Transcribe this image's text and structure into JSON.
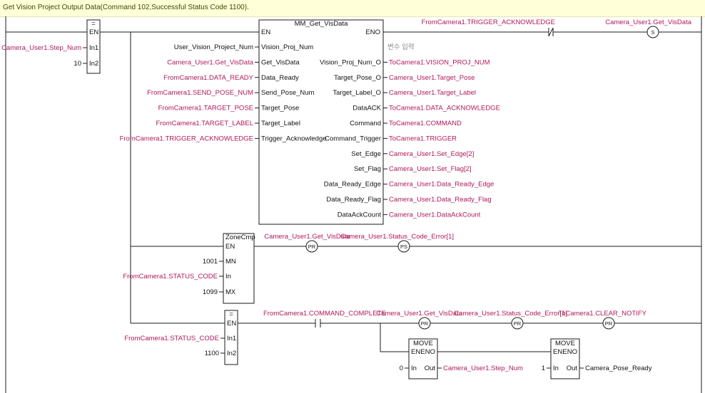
{
  "banner": {
    "comment": "Get Vision Project Output Data(Command 102,Successful Status Code 1100)."
  },
  "rung1": {
    "eq_block": {
      "title": "=",
      "en": "EN",
      "in1": "In1",
      "in2": "In2",
      "in1_var": "Camera_User1.Step_Num",
      "in2_const": "10"
    },
    "fb": {
      "title": "MM_Get_VisData",
      "en": "EN",
      "eno": "ENO",
      "inputs": [
        {
          "pin": "Vision_Proj_Num",
          "var": "User_Vision_Project_Num"
        },
        {
          "pin": "Get_VisData",
          "var": "Camera_User1.Get_VisData"
        },
        {
          "pin": "Data_Ready",
          "var": "FromCamera1.DATA_READY"
        },
        {
          "pin": "Send_Pose_Num",
          "var": "FromCamera1.SEND_POSE_NUM"
        },
        {
          "pin": "Target_Pose",
          "var": "FromCamera1.TARGET_POSE"
        },
        {
          "pin": "Target_Label",
          "var": "FromCamera1.TARGET_LABEL"
        },
        {
          "pin": "Trigger_Acknowledge",
          "var": "FromCamera1.TRIGGER_ACKNOWLEDGE"
        }
      ],
      "eno_out": "변수 입력",
      "outputs": [
        {
          "pin": "Vision_Proj_Num_O",
          "var": "ToCamera1.VISION_PROJ_NUM"
        },
        {
          "pin": "Target_Pose_O",
          "var": "Camera_User1.Target_Pose"
        },
        {
          "pin": "Target_Label_O",
          "var": "Camera_User1.Target_Label"
        },
        {
          "pin": "DataACK",
          "var": "ToCamera1.DATA_ACKNOWLEDGE"
        },
        {
          "pin": "Command",
          "var": "ToCamera1.COMMAND"
        },
        {
          "pin": "Command_Trigger",
          "var": "ToCamera1.TRIGGER"
        },
        {
          "pin": "Set_Edge",
          "var": "Camera_User1.Set_Edge[2]"
        },
        {
          "pin": "Set_Flag",
          "var": "Camera_User1.Set_Flag[2]"
        },
        {
          "pin": "Data_Ready_Edge",
          "var": "Camera_User1.Data_Ready_Edge"
        },
        {
          "pin": "Data_Ready_Flag",
          "var": "Camera_User1.Data_Ready_Flag"
        },
        {
          "pin": "DataAckCount",
          "var": "Camera_User1.DataAckCount"
        }
      ]
    },
    "contact_nc": {
      "var": "FromCamera1.TRIGGER_ACKNOWLEDGE",
      "symbol": "/"
    },
    "coil_set": {
      "var": "Camera_User1.Get_VisData",
      "symbol": "S"
    }
  },
  "rung2": {
    "zone": {
      "title": "ZoneCmp",
      "en": "EN",
      "mn": "MN",
      "in": "In",
      "mx": "MX",
      "mn_const": "1001",
      "in_var": "FromCamera1.STATUS_CODE",
      "mx_const": "1099"
    },
    "coil1": {
      "var": "Camera_User1.Get_VisData",
      "symbol": "PR"
    },
    "coil2": {
      "var": "Camera_User1.Status_Code_Error[1]",
      "symbol": "PS"
    }
  },
  "rung3": {
    "eq_block": {
      "title": "=",
      "en": "EN",
      "in1": "In1",
      "in2": "In2",
      "in1_var": "FromCamera1.STATUS_CODE",
      "in2_const": "1100"
    },
    "contact_no": {
      "var": "FromCamera1.COMMAND_COMPLETE"
    },
    "coil1": {
      "var": "Camera_User1.Get_VisData",
      "symbol": "PR"
    },
    "coil2": {
      "var": "Camera_User1.Status_Code_Error[1]",
      "symbol": "PR"
    },
    "coil3": {
      "var": "ToCamera1.CLEAR_NOTIFY",
      "symbol": "PR"
    },
    "move1": {
      "title": "MOVE",
      "en": "EN",
      "eno": "ENO",
      "in": "In",
      "out": "Out",
      "in_const": "0",
      "out_var": "Camera_User1.Step_Num"
    },
    "move2": {
      "title": "MOVE",
      "en": "EN",
      "eno": "ENO",
      "in": "In",
      "out": "Out",
      "in_const": "1",
      "out_var": "Camera_Pose_Ready"
    }
  }
}
